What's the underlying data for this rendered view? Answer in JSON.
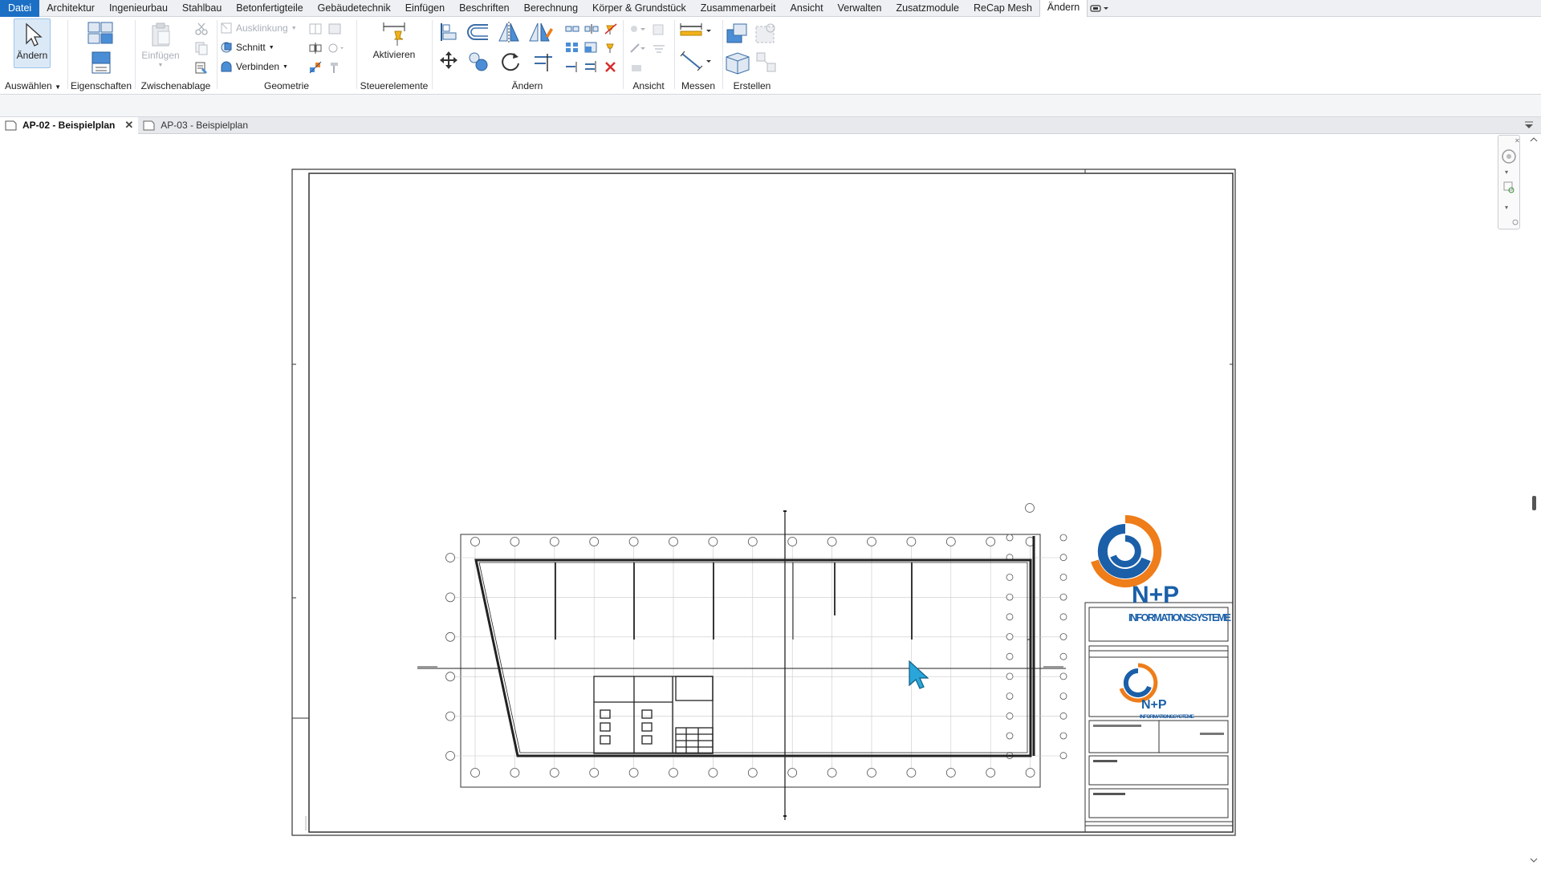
{
  "menubar": {
    "tabs": [
      "Datei",
      "Architektur",
      "Ingenieurbau",
      "Stahlbau",
      "Betonfertigteile",
      "Gebäudetechnik",
      "Einfügen",
      "Beschriften",
      "Berechnung",
      "Körper & Grundstück",
      "Zusammenarbeit",
      "Ansicht",
      "Verwalten",
      "Zusatzmodule",
      "ReCap Mesh",
      "Ändern"
    ],
    "active_tab": "Ändern"
  },
  "ribbon": {
    "select": {
      "modify_label": "Ändern",
      "panel_label": "Auswählen"
    },
    "properties": {
      "panel_label": "Eigenschaften"
    },
    "clipboard": {
      "paste_label": "Einfügen",
      "panel_label": "Zwischenablage"
    },
    "geometry": {
      "cope_label": "Ausklinkung",
      "cut_label": "Schnitt",
      "join_label": "Verbinden",
      "panel_label": "Geometrie"
    },
    "controls": {
      "activate_label": "Aktivieren",
      "panel_label": "Steuerelemente"
    },
    "modify": {
      "panel_label": "Ändern"
    },
    "view": {
      "panel_label": "Ansicht"
    },
    "measure": {
      "panel_label": "Messen"
    },
    "create": {
      "panel_label": "Erstellen"
    }
  },
  "doc_tabs": [
    {
      "label": "AP-02 - Beispielplan",
      "active": true
    },
    {
      "label": "AP-03 - Beispielplan",
      "active": false
    }
  ],
  "titleblock": {
    "company": "INFORMATIONSSYSTEME",
    "logo_text": "N+P"
  },
  "colors": {
    "file_tab": "#1b6fc4",
    "logo_blue": "#1a5fa8",
    "logo_orange": "#ee7d1a",
    "cursor": "#2aa5d9"
  }
}
